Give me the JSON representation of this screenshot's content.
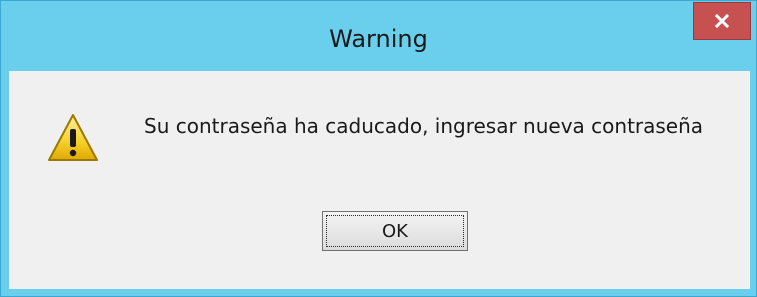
{
  "dialog": {
    "title": "Warning",
    "message": "Su contraseña ha caducado, ingresar nueva contraseña",
    "ok_label": "OK",
    "close_icon": "close-icon",
    "message_icon": "warning-icon"
  },
  "colors": {
    "titlebar": "#6acfec",
    "close_button": "#c75050",
    "content_background": "#f0f0f0",
    "warning_yellow": "#f5d02a"
  }
}
